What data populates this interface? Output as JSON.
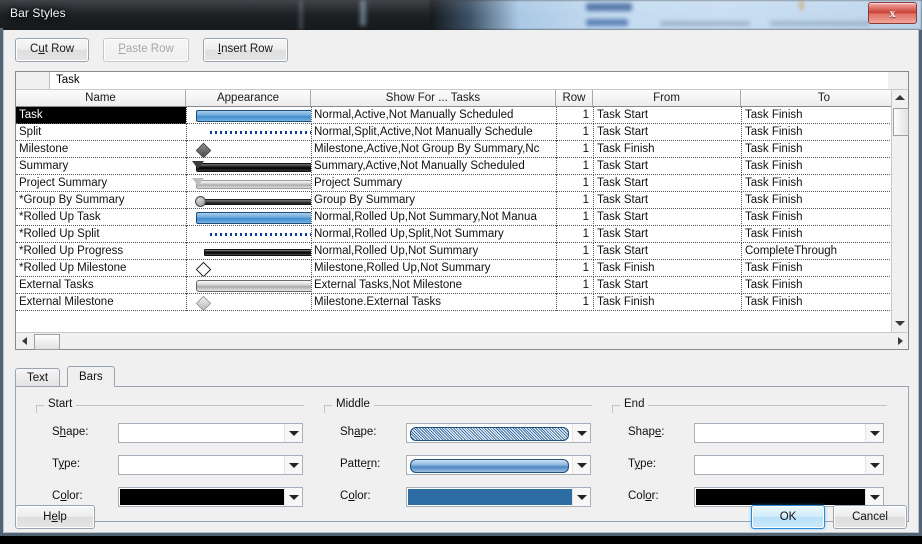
{
  "window": {
    "title": "Bar Styles",
    "close_label": "x"
  },
  "toolbar": {
    "cut_row": {
      "pre": "C",
      "accel": "u",
      "post": "t Row"
    },
    "paste_row": {
      "pre": "",
      "accel": "P",
      "post": "aste Row"
    },
    "insert_row": {
      "pre": "",
      "accel": "I",
      "post": "nsert Row"
    }
  },
  "edit_row": {
    "value": "Task"
  },
  "grid": {
    "headers": [
      "Name",
      "Appearance",
      "Show For ... Tasks",
      "Row",
      "From",
      "To"
    ],
    "rows": [
      {
        "name": "Task",
        "appearance": "bar-blue",
        "show_for": "Normal,Active,Not Manually Scheduled",
        "row": "1",
        "from": "Task Start",
        "to": "Task Finish",
        "selected": true
      },
      {
        "name": "Split",
        "appearance": "bar-dotted",
        "show_for": "Normal,Split,Active,Not Manually Schedule",
        "row": "1",
        "from": "Task Start",
        "to": "Task Finish",
        "selected": false
      },
      {
        "name": "Milestone",
        "appearance": "dia-dark",
        "show_for": "Milestone,Active,Not Group By Summary,Nc",
        "row": "1",
        "from": "Task Finish",
        "to": "Task Finish",
        "selected": false
      },
      {
        "name": "Summary",
        "appearance": "summary",
        "show_for": "Summary,Active,Not Manually Scheduled",
        "row": "1",
        "from": "Task Start",
        "to": "Task Finish",
        "selected": false
      },
      {
        "name": "Project Summary",
        "appearance": "project",
        "show_for": "Project Summary",
        "row": "1",
        "from": "Task Start",
        "to": "Task Finish",
        "selected": false
      },
      {
        "name": "*Group By Summary",
        "appearance": "group",
        "show_for": "Group By Summary",
        "row": "1",
        "from": "Task Start",
        "to": "Task Finish",
        "selected": false
      },
      {
        "name": "*Rolled Up Task",
        "appearance": "bar-blue",
        "show_for": "Normal,Rolled Up,Not Summary,Not Manua",
        "row": "1",
        "from": "Task Start",
        "to": "Task Finish",
        "selected": false
      },
      {
        "name": "*Rolled Up Split",
        "appearance": "bar-dotted",
        "show_for": "Normal,Rolled Up,Split,Not Summary",
        "row": "1",
        "from": "Task Start",
        "to": "Task Finish",
        "selected": false
      },
      {
        "name": "*Rolled Up Progress",
        "appearance": "progress",
        "show_for": "Normal,Rolled Up,Not Summary",
        "row": "1",
        "from": "Task Start",
        "to": "CompleteThrough",
        "selected": false
      },
      {
        "name": "*Rolled Up Milestone",
        "appearance": "dia-open",
        "show_for": "Milestone,Rolled Up,Not Summary",
        "row": "1",
        "from": "Task Finish",
        "to": "Task Finish",
        "selected": false
      },
      {
        "name": "External Tasks",
        "appearance": "ext-bar",
        "show_for": "External Tasks,Not Milestone",
        "row": "1",
        "from": "Task Start",
        "to": "Task Finish",
        "selected": false
      },
      {
        "name": "External Milestone",
        "appearance": "dia-light",
        "show_for": "Milestone.External Tasks",
        "row": "1",
        "from": "Task Finish",
        "to": "Task Finish",
        "selected": false
      }
    ]
  },
  "tabs": [
    {
      "label": "Text",
      "active": false
    },
    {
      "label": "Bars",
      "active": true
    }
  ],
  "bars_panel": {
    "start": {
      "legend": "Start",
      "fields": [
        {
          "pre": "S",
          "accel": "h",
          "post": "ape:",
          "kind": "empty"
        },
        {
          "pre": "T",
          "accel": "y",
          "post": "pe:",
          "kind": "empty"
        },
        {
          "pre": "C",
          "accel": "o",
          "post": "lor:",
          "kind": "color",
          "color": "#000000"
        }
      ]
    },
    "middle": {
      "legend": "Middle",
      "fields": [
        {
          "pre": "Sh",
          "accel": "a",
          "post": "pe:",
          "kind": "shape"
        },
        {
          "pre": "Patte",
          "accel": "r",
          "post": "n:",
          "kind": "pattern"
        },
        {
          "pre": "C",
          "accel": "o",
          "post": "lor:",
          "kind": "color",
          "color": "#2e6da4"
        }
      ]
    },
    "end": {
      "legend": "End",
      "fields": [
        {
          "pre": "Shap",
          "accel": "e",
          "post": ":",
          "kind": "empty"
        },
        {
          "pre": "T",
          "accel": "y",
          "post": "pe:",
          "kind": "empty"
        },
        {
          "pre": "Col",
          "accel": "o",
          "post": "r:",
          "kind": "color",
          "color": "#000000"
        }
      ]
    }
  },
  "footer": {
    "help": {
      "pre": "H",
      "accel": "e",
      "post": "lp"
    },
    "ok": "OK",
    "cancel": "Cancel"
  },
  "colors": {
    "accent_blue": "#2e6da4",
    "dialog_bg": "#f0f0f0",
    "selection_bg": "#000000",
    "close_red": "#c73c33"
  }
}
